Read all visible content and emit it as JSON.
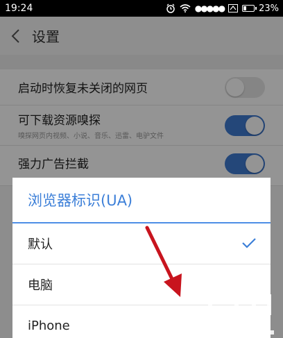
{
  "status_bar": {
    "time": "19:24",
    "signal": "●●●●●",
    "battery_pct": "23%"
  },
  "header": {
    "title": "设置"
  },
  "settings": [
    {
      "label": "启动时恢复未关闭的网页",
      "sub": "",
      "state": "off"
    },
    {
      "label": "可下载资源嗅探",
      "sub": "嗅探网页内视频、小说、音乐、迅雷、电驴文件",
      "state": "on"
    },
    {
      "label": "强力广告拦截",
      "sub": "",
      "state": "on"
    }
  ],
  "dialog": {
    "title": "浏览器标识(UA)",
    "options": [
      {
        "label": "默认",
        "selected": true
      },
      {
        "label": "电脑",
        "selected": false
      },
      {
        "label": "iPhone",
        "selected": false
      }
    ]
  },
  "colors": {
    "accent": "#3c7fd8",
    "toggle_on": "#3f7ad1",
    "arrow": "#c8141e"
  }
}
